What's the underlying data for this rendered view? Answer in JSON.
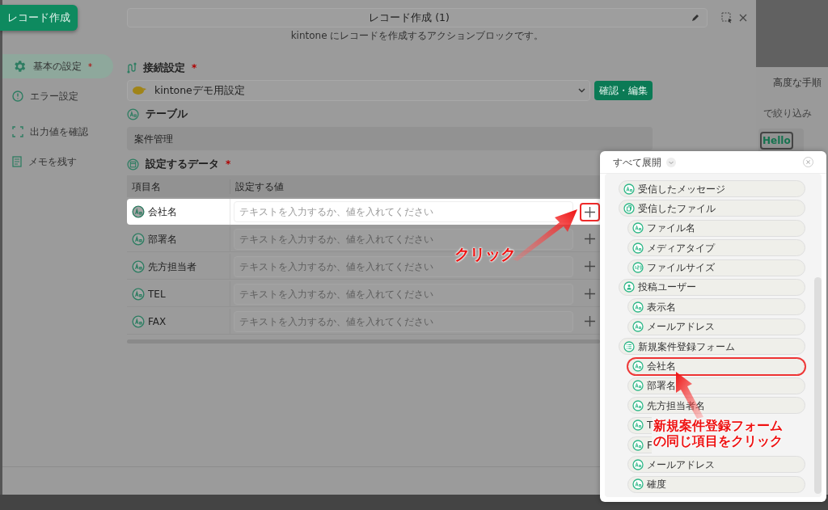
{
  "launcher_button": "レコード作成",
  "dialog": {
    "title": "レコード作成 (1)",
    "subtitle": "kintone にレコードを作成するアクションブロックです。"
  },
  "sidebar": {
    "items": [
      {
        "kind": "gear",
        "label": "基本の設定",
        "mark": "*",
        "selected": true
      },
      {
        "kind": "alert",
        "label": "エラー設定",
        "selected": false
      },
      {
        "kind": "frame",
        "label": "出力値を確認",
        "selected": false
      },
      {
        "kind": "memo",
        "label": "メモを残す",
        "selected": false
      }
    ]
  },
  "connection": {
    "heading": "接続設定",
    "mark": "*",
    "value": "kintoneデモ用設定",
    "button": "確認・編集"
  },
  "table_section": {
    "heading": "テーブル",
    "value": "案件管理"
  },
  "data_section": {
    "heading": "設定するデータ",
    "mark": "*",
    "columns": [
      "項目名",
      "設定する値"
    ],
    "rows": [
      {
        "name": "会社名",
        "placeholder": "テキストを入力するか、値を入れてください",
        "highlighted": true,
        "outlined": true
      },
      {
        "name": "部署名",
        "placeholder": "テキストを入力するか、値を入れてください",
        "highlighted": false,
        "outlined": false
      },
      {
        "name": "先方担当者",
        "placeholder": "テキストを入力するか、値を入れてください",
        "highlighted": false,
        "outlined": false
      },
      {
        "name": "TEL",
        "placeholder": "テキストを入力するか、値を入れてください",
        "highlighted": false,
        "outlined": false
      },
      {
        "name": "FAX",
        "placeholder": "テキストを入力するか、値を入れてください",
        "highlighted": false,
        "outlined": false
      }
    ]
  },
  "background": {
    "texts": [
      "高度な手順",
      "で絞り込み"
    ],
    "card_label": "Hello"
  },
  "picker": {
    "header": "すべて展開",
    "items": [
      {
        "kind": "text",
        "label": "受信したメッセージ",
        "outlined": false
      },
      {
        "kind": "file",
        "label": "受信したファイル",
        "outlined": false,
        "children": [
          {
            "kind": "text",
            "label": "ファイル名",
            "outlined": false
          },
          {
            "kind": "text",
            "label": "メディアタイプ",
            "outlined": false
          },
          {
            "kind": "number",
            "label": "ファイルサイズ",
            "outlined": false
          }
        ]
      },
      {
        "kind": "user",
        "label": "投稿ユーザー",
        "outlined": false,
        "children": [
          {
            "kind": "text",
            "label": "表示名",
            "outlined": false
          },
          {
            "kind": "text",
            "label": "メールアドレス",
            "outlined": false
          }
        ]
      },
      {
        "kind": "list",
        "label": "新規案件登録フォーム",
        "outlined": false,
        "children": [
          {
            "kind": "text",
            "label": "会社名",
            "outlined": true
          },
          {
            "kind": "text",
            "label": "部署名",
            "outlined": false
          },
          {
            "kind": "text",
            "label": "先方担当者名",
            "outlined": false
          },
          {
            "kind": "text",
            "label": "T",
            "outlined": false,
            "covered": true
          },
          {
            "kind": "text",
            "label": "F",
            "outlined": false,
            "covered": true
          },
          {
            "kind": "text",
            "label": "メールアドレス",
            "outlined": false
          },
          {
            "kind": "text",
            "label": "確度",
            "outlined": false
          }
        ]
      }
    ]
  },
  "annotations": {
    "click_label": "クリック",
    "hint_lines": [
      "新規案件登録フォーム",
      "の同じ項目をクリック"
    ]
  }
}
